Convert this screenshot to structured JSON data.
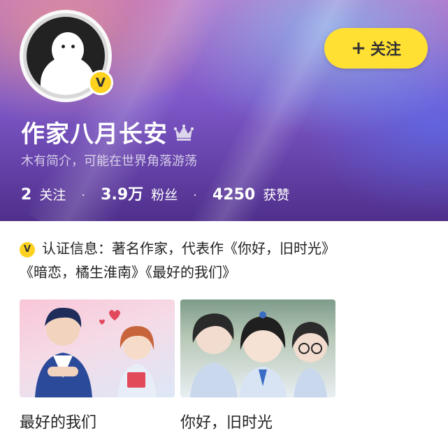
{
  "profile": {
    "name": "作家八月长安",
    "bio": "木有简介，可能在世界角落游荡",
    "verified_badge": "V",
    "follow_button": {
      "icon": "+",
      "label": "关注"
    },
    "stats": [
      {
        "value": "2",
        "label": "关注"
      },
      {
        "value": "3.9万",
        "label": "粉丝"
      },
      {
        "value": "4250",
        "label": "获赞"
      }
    ],
    "stat_separator": "·"
  },
  "certification": {
    "icon": "V",
    "line1": "认证信息：著名作家，代表作《你好，旧时光》",
    "line2": "《暗恋，橘生淮南》《最好的我们》"
  },
  "works": [
    {
      "title": "最好的我们"
    },
    {
      "title": "你好，旧时光"
    }
  ],
  "colors": {
    "accent_yellow": "#ffe033",
    "badge_yellow": "#ffd21f"
  },
  "icons": [
    "avatar-ghost-icon",
    "verified-v-icon",
    "crown-icon",
    "plus-icon",
    "cert-v-icon"
  ]
}
